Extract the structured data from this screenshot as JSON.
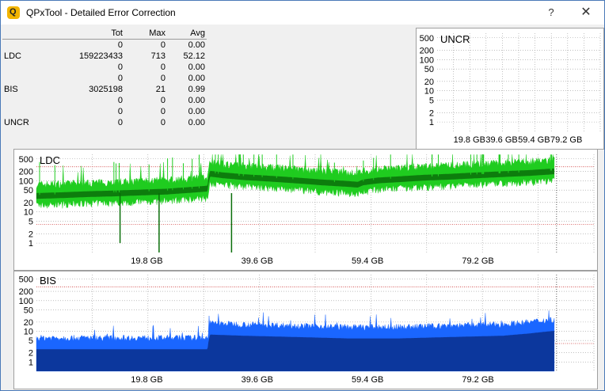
{
  "window": {
    "title": "QPxTool - Detailed Error Correction",
    "help_label": "?",
    "close_label": "✕",
    "app_icon": "Q"
  },
  "stats": {
    "headers": [
      "",
      "Tot",
      "Max",
      "Avg"
    ],
    "rows": [
      [
        "",
        "0",
        "0",
        "0.00"
      ],
      [
        "LDC",
        "159223433",
        "713",
        "52.12"
      ],
      [
        "",
        "0",
        "0",
        "0.00"
      ],
      [
        "",
        "0",
        "0",
        "0.00"
      ],
      [
        "BIS",
        "3025198",
        "21",
        "0.99"
      ],
      [
        "",
        "0",
        "0",
        "0.00"
      ],
      [
        "",
        "0",
        "0",
        "0.00"
      ],
      [
        "UNCR",
        "0",
        "0",
        "0.00"
      ]
    ]
  },
  "colors": {
    "ldc_light": "#1fcc1f",
    "ldc_dark": "#0a6e0a",
    "bis_light": "#1a66ff",
    "bis_dark": "#0a2f8c",
    "limit_line": "#d04040",
    "grid": "#9a9a9a"
  },
  "chart_data": [
    {
      "type": "area",
      "title": "UNCR",
      "y_scale": "log",
      "yticks": [
        "500",
        "200",
        "100",
        "50",
        "20",
        "10",
        "5",
        "2",
        "1"
      ],
      "xticks": [
        "19.8 GB",
        "39.6 GB",
        "59.4 GB",
        "79.2 GB"
      ],
      "series": [
        {
          "values": []
        }
      ]
    },
    {
      "type": "area",
      "title": "LDC",
      "y_scale": "log",
      "yticks": [
        "500",
        "200",
        "100",
        "50",
        "20",
        "10",
        "5",
        "2",
        "1"
      ],
      "xticks": [
        "19.8 GB",
        "39.6 GB",
        "59.4 GB",
        "79.2 GB"
      ],
      "x_unit": "GB",
      "x_max": 100,
      "limit_lines": [
        280,
        4
      ],
      "series": [
        {
          "x": [
            0,
            5,
            10,
            15,
            20,
            25,
            30,
            33,
            33.5,
            36,
            40,
            45,
            50,
            55,
            60,
            62,
            63,
            66,
            70,
            75,
            80,
            85,
            90,
            95,
            100
          ],
          "y": [
            35,
            37,
            40,
            42,
            45,
            48,
            55,
            60,
            180,
            160,
            140,
            125,
            110,
            95,
            85,
            80,
            95,
            110,
            120,
            135,
            145,
            160,
            175,
            190,
            215
          ]
        }
      ]
    },
    {
      "type": "area",
      "title": "BIS",
      "y_scale": "log",
      "yticks": [
        "500",
        "200",
        "100",
        "50",
        "20",
        "10",
        "5",
        "2",
        "1"
      ],
      "xticks": [
        "19.8 GB",
        "39.6 GB",
        "59.4 GB",
        "79.2 GB"
      ],
      "x_unit": "GB",
      "x_max": 100,
      "limit_lines": [
        280,
        4
      ],
      "series": [
        {
          "x": [
            0,
            10,
            20,
            30,
            33,
            33.5,
            40,
            50,
            60,
            70,
            80,
            90,
            95,
            100
          ],
          "y": [
            4,
            4,
            4,
            4,
            4,
            12,
            11,
            10,
            9,
            9,
            10,
            11,
            13,
            16
          ]
        }
      ]
    }
  ]
}
